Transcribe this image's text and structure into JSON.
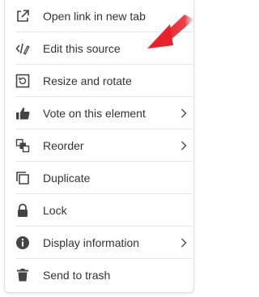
{
  "menu": {
    "items": [
      {
        "label": "Open link in new tab",
        "icon": "external-link-icon",
        "submenu": false
      },
      {
        "label": "Edit this source",
        "icon": "code-edit-icon",
        "submenu": false
      },
      {
        "label": "Resize and rotate",
        "icon": "resize-rotate-icon",
        "submenu": false
      },
      {
        "label": "Vote on this element",
        "icon": "thumbs-up-icon",
        "submenu": true
      },
      {
        "label": "Reorder",
        "icon": "reorder-layers-icon",
        "submenu": true
      },
      {
        "label": "Duplicate",
        "icon": "duplicate-icon",
        "submenu": false
      },
      {
        "label": "Lock",
        "icon": "lock-icon",
        "submenu": false
      },
      {
        "label": "Display information",
        "icon": "info-icon",
        "submenu": true
      },
      {
        "label": "Send to trash",
        "icon": "trash-icon",
        "submenu": false
      }
    ]
  },
  "annotation": {
    "arrow_color": "#e8202a",
    "points_to": "Edit this source"
  }
}
